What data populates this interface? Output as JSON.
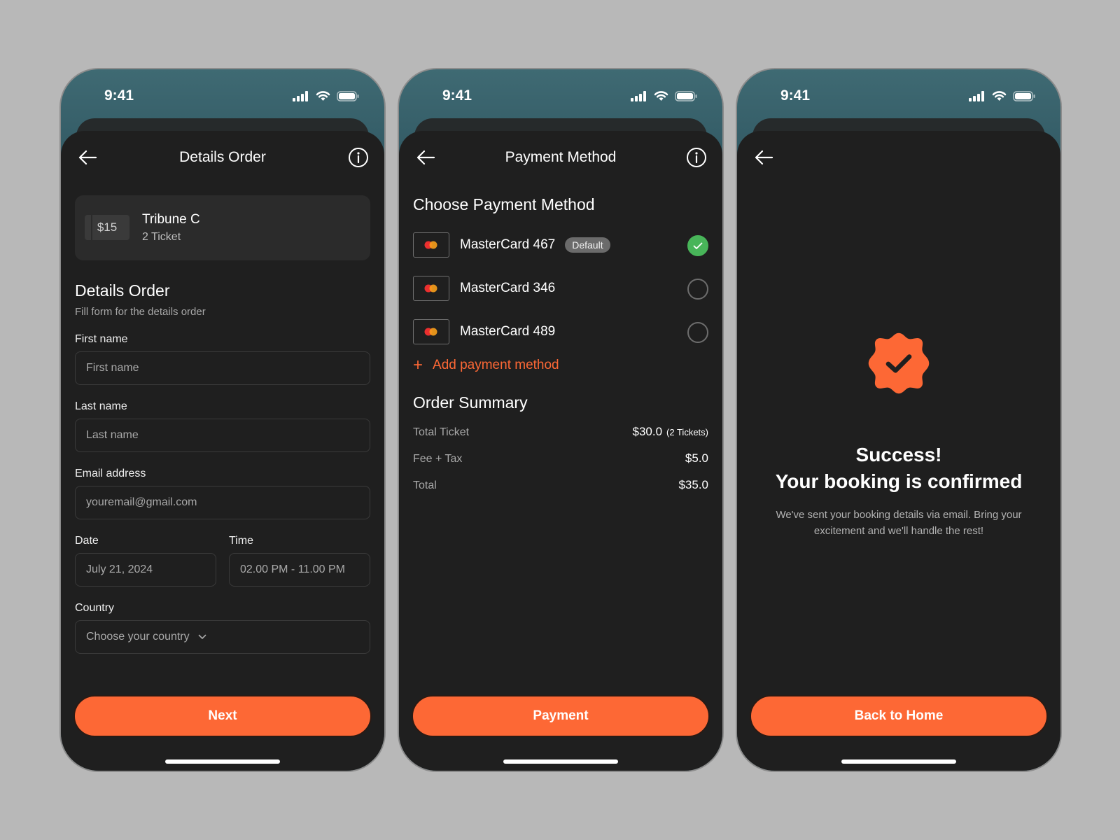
{
  "status": {
    "time": "9:41"
  },
  "colors": {
    "accent": "#fd6835",
    "success": "#48b559",
    "background": "#b8b8b8",
    "sheet": "#1f1f1f"
  },
  "screen1": {
    "title": "Details Order",
    "ticket": {
      "price": "$15",
      "name": "Tribune C",
      "count": "2 Ticket"
    },
    "section_title": "Details Order",
    "section_sub": "Fill form for the details order",
    "fields": {
      "first_name": {
        "label": "First name",
        "placeholder": "First name"
      },
      "last_name": {
        "label": "Last name",
        "placeholder": "Last name"
      },
      "email": {
        "label": "Email address",
        "placeholder": "youremail@gmail.com"
      },
      "date": {
        "label": "Date",
        "value": "July 21, 2024"
      },
      "time": {
        "label": "Time",
        "value": "02.00 PM - 11.00 PM"
      },
      "country": {
        "label": "Country",
        "placeholder": "Choose your country"
      }
    },
    "cta": "Next"
  },
  "screen2": {
    "title": "Payment Method",
    "choose_title": "Choose Payment Method",
    "methods": [
      {
        "name": "MasterCard 467",
        "badge": "Default",
        "selected": true
      },
      {
        "name": "MasterCard 346",
        "selected": false
      },
      {
        "name": "MasterCard 489",
        "selected": false
      }
    ],
    "add_method": "Add payment method",
    "summary_title": "Order Summary",
    "summary": {
      "total_ticket": {
        "label": "Total Ticket",
        "value": "$30.0",
        "note": "(2 Tickets)"
      },
      "fee_tax": {
        "label": "Fee + Tax",
        "value": "$5.0"
      },
      "total": {
        "label": "Total",
        "value": "$35.0"
      }
    },
    "cta": "Payment"
  },
  "screen3": {
    "title_line1": "Success!",
    "title_line2": "Your booking is confirmed",
    "description": "We've sent your booking details via email. Bring your excitement and we'll handle the rest!",
    "cta": "Back to Home"
  }
}
